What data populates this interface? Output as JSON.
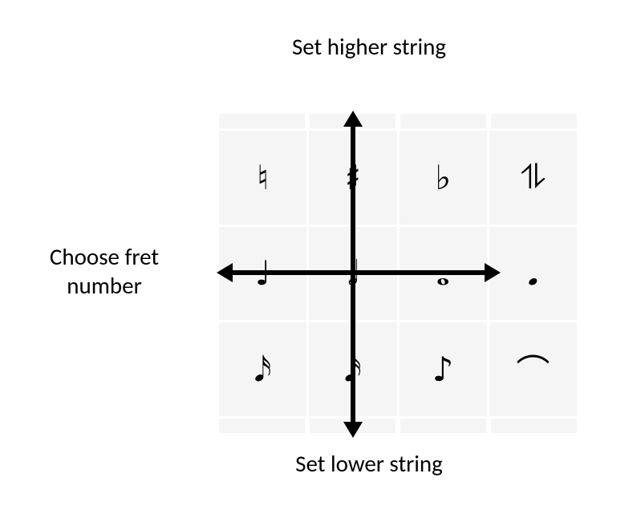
{
  "labels": {
    "top": "Set higher string",
    "left_line1": "Choose fret",
    "left_line2": "number",
    "bottom": "Set lower string"
  },
  "grid": {
    "cells": [
      [
        "♮",
        "♯",
        "♭",
        "⥮"
      ],
      [
        "♩",
        "𝅗𝅥",
        "𝅝",
        "𝅘"
      ],
      [
        "𝅘𝅥𝅯",
        "𝅘𝅥𝅯",
        "♪",
        "⌒"
      ]
    ],
    "semantics": [
      [
        "natural-sign",
        "sharp-sign",
        "flat-sign",
        "tremolo-ornament"
      ],
      [
        "quarter-note",
        "half-note",
        "whole-note",
        "double-whole-note"
      ],
      [
        "sixteenth-note",
        "sixteenth-note-2",
        "eighth-note",
        "fermata-arc"
      ]
    ]
  },
  "arrows": {
    "up": "set-higher-string-arrow",
    "down": "set-lower-string-arrow",
    "left": "choose-fret-left-arrow",
    "right": "choose-fret-right-arrow"
  }
}
